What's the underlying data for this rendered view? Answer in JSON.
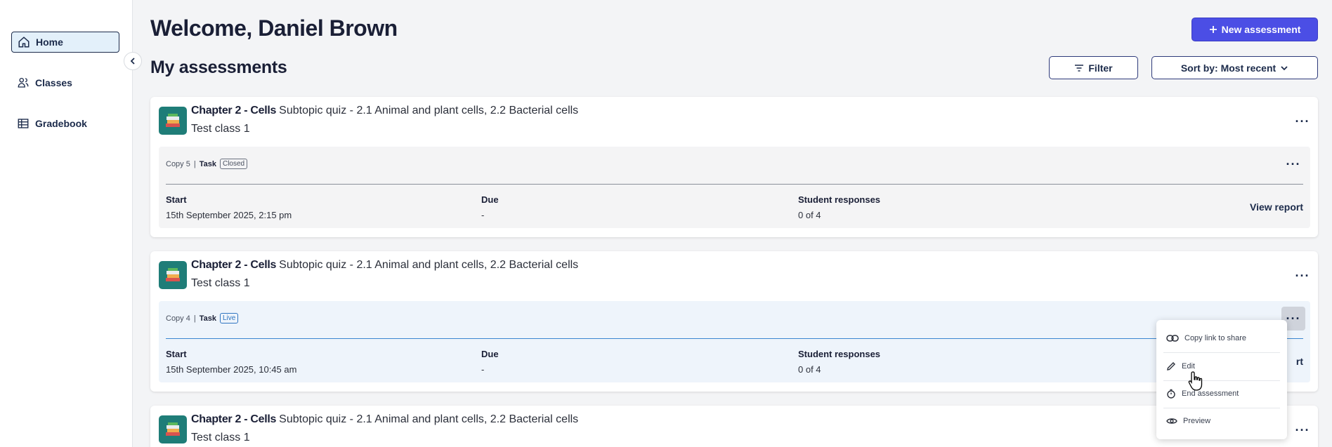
{
  "sidebar": {
    "items": [
      {
        "label": "Home",
        "icon": "home-icon",
        "active": true
      },
      {
        "label": "Classes",
        "icon": "classes-icon",
        "active": false
      },
      {
        "label": "Gradebook",
        "icon": "gradebook-icon",
        "active": false
      }
    ]
  },
  "header": {
    "welcome": "Welcome, Daniel Brown",
    "section_title": "My assessments",
    "new_button": "New assessment",
    "filter_button": "Filter",
    "sort_button": "Sort by: Most recent"
  },
  "columns": {
    "start": "Start",
    "due": "Due",
    "responses": "Student responses"
  },
  "cards": [
    {
      "chapter": "Chapter 2 - Cells",
      "subtitle": "Subtopic quiz - 2.1 Animal and plant cells, 2.2 Bacterial cells",
      "class_name": "Test class 1",
      "copy": "Copy 5",
      "separator": "|",
      "type": "Task",
      "status": "Closed",
      "start": "15th September 2025, 2:15 pm",
      "due": "-",
      "responses": "0 of 4",
      "action": "View report"
    },
    {
      "chapter": "Chapter 2 - Cells",
      "subtitle": "Subtopic quiz - 2.1 Animal and plant cells, 2.2 Bacterial cells",
      "class_name": "Test class 1",
      "copy": "Copy 4",
      "separator": "|",
      "type": "Task",
      "status": "Live",
      "start": "15th September 2025, 10:45 am",
      "due": "-",
      "responses": "0 of 4",
      "action": "rt"
    },
    {
      "chapter": "Chapter 2 - Cells",
      "subtitle": "Subtopic quiz - 2.1 Animal and plant cells, 2.2 Bacterial cells",
      "class_name": "Test class 1"
    }
  ],
  "menu": {
    "items": [
      {
        "label": "Copy link to share",
        "icon": "link-icon"
      },
      {
        "label": "Edit",
        "icon": "pencil-icon"
      },
      {
        "label": "End assessment",
        "icon": "stopwatch-icon"
      },
      {
        "label": "Preview",
        "icon": "eye-icon"
      }
    ]
  },
  "more_glyph": "···",
  "colors": {
    "primary": "#4b4ee5",
    "navy": "#1b2a4a",
    "teal_icon": "#1f7d78",
    "live": "#2f74c0",
    "active_nav_bg": "#e3f0fa"
  }
}
